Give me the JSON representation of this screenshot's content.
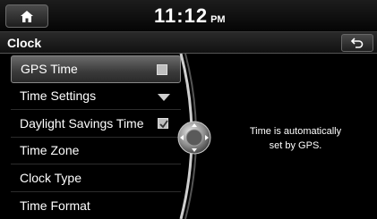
{
  "status_bar": {
    "time": "11:12",
    "ampm": "PM",
    "home_icon": "home-icon"
  },
  "title_bar": {
    "title": "Clock",
    "back_icon": "back-arrow-icon"
  },
  "menu": {
    "items": [
      {
        "label": "GPS Time",
        "control": "checkbox",
        "checked": false,
        "selected": true
      },
      {
        "label": "Time Settings",
        "control": "dropdown",
        "selected": false
      },
      {
        "label": "Daylight Savings Time",
        "control": "checkbox",
        "checked": true,
        "selected": false
      },
      {
        "label": "Time Zone",
        "control": "none",
        "selected": false
      },
      {
        "label": "Clock Type",
        "control": "none",
        "selected": false
      },
      {
        "label": "Time Format",
        "control": "none",
        "selected": false
      }
    ]
  },
  "info": {
    "line1": "Time is automatically",
    "line2": "set by GPS."
  },
  "colors": {
    "background": "#000000",
    "text": "#ffffff",
    "selected_item": "#555555"
  }
}
